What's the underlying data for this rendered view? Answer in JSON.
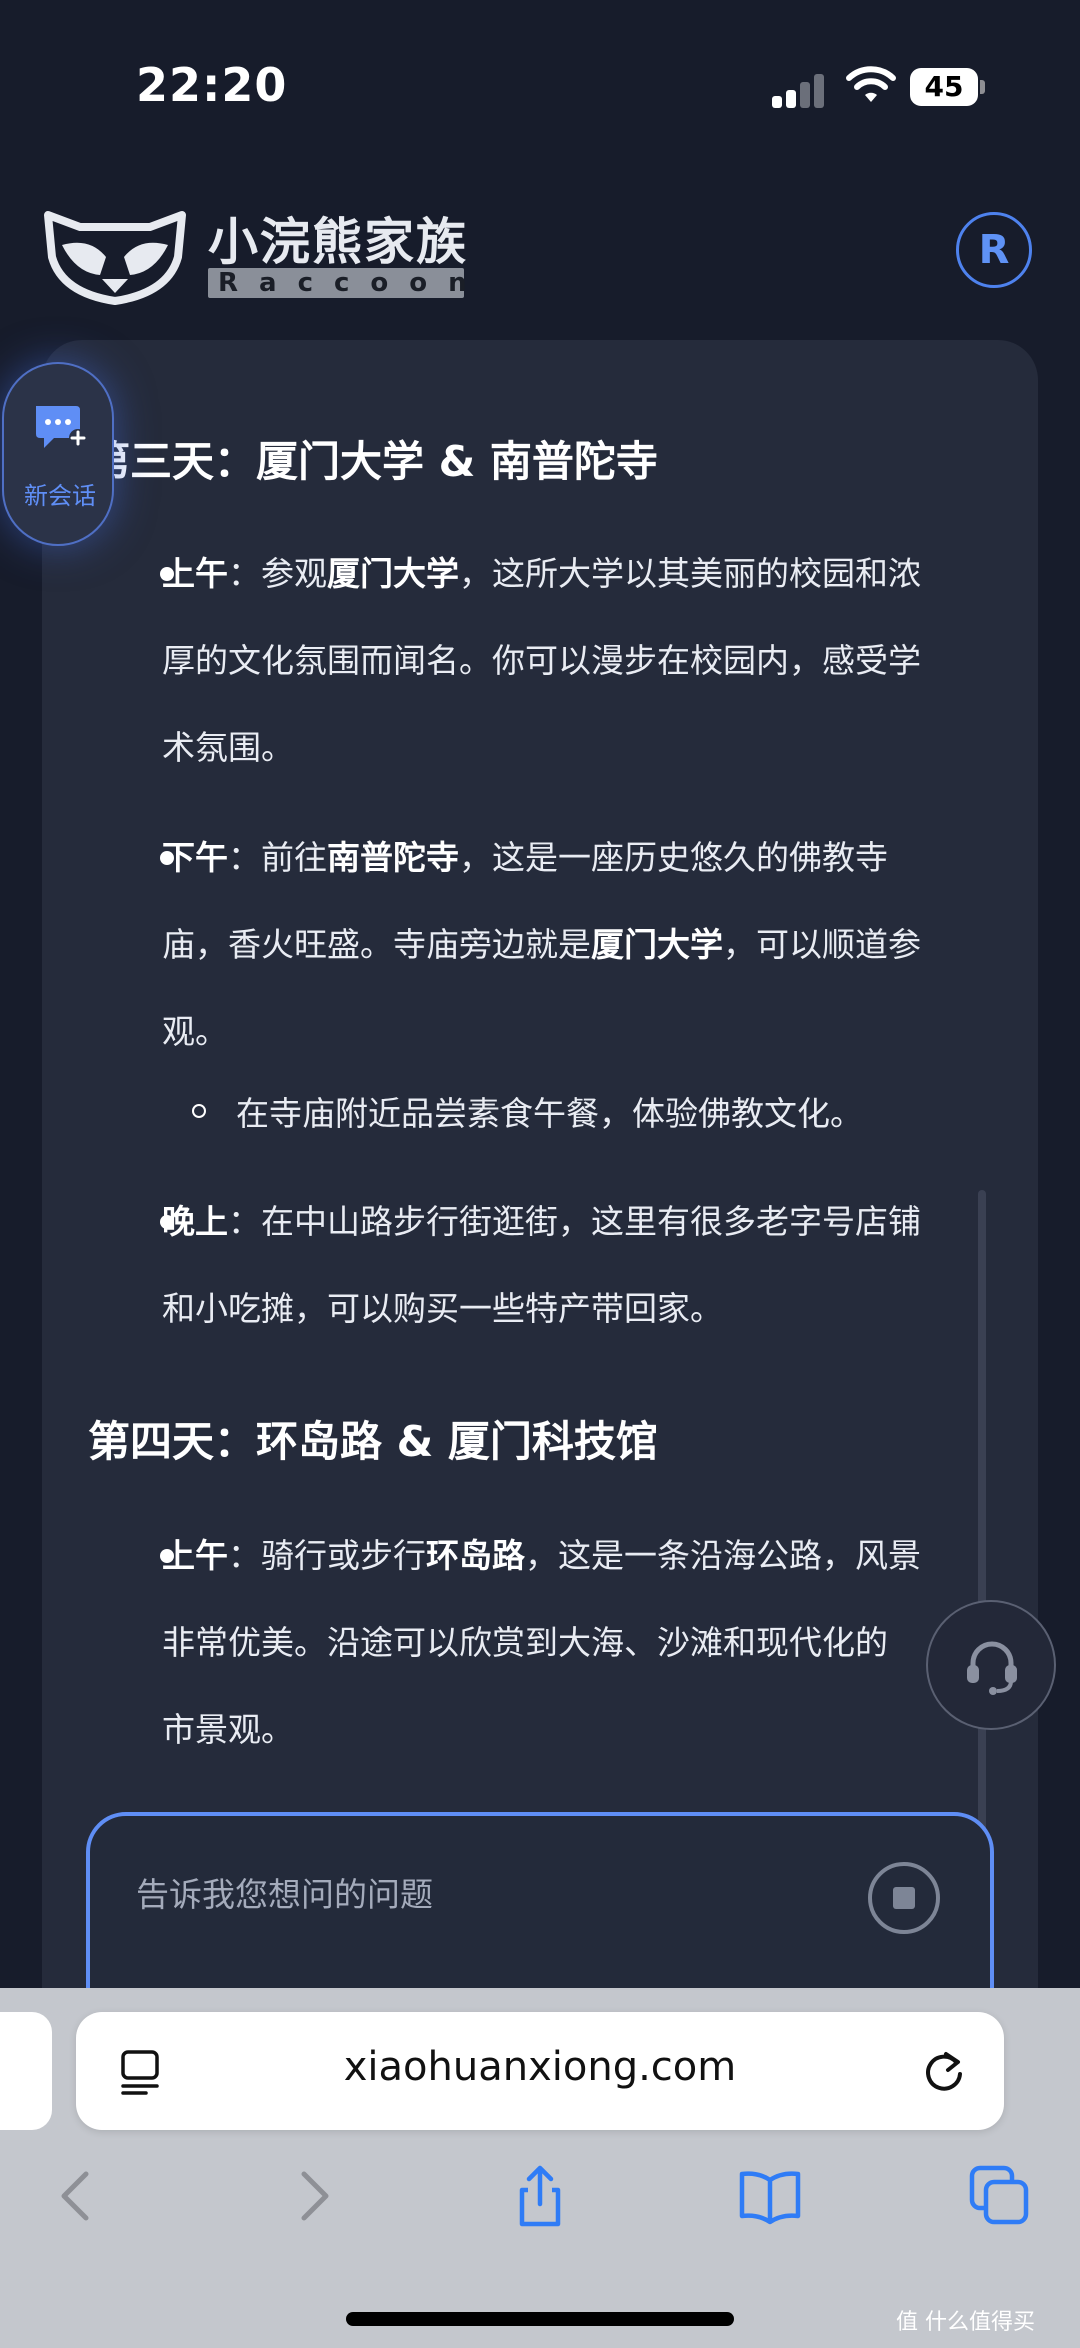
{
  "status_bar": {
    "time": "22:20",
    "battery": "45"
  },
  "header": {
    "brand_name": "小浣熊家族",
    "brand_sub": "Raccoon",
    "avatar_letter": "R"
  },
  "floating": {
    "new_chat_label": "新会话"
  },
  "chat": {
    "day3": {
      "title": "第三天：厦门大学 & 南普陀寺",
      "morning": {
        "label": "上午",
        "lines": [
          [
            "：参观",
            "厦门大学",
            "，这所大学以其美丽的校园和浓"
          ],
          "厚的文化氛围而闻名。你可以漫步在校园内，感受学",
          "术氛围。"
        ]
      },
      "afternoon": {
        "label": "下午",
        "lines": [
          [
            "：前往",
            "南普陀寺",
            "，这是一座历史悠久的佛教寺"
          ],
          [
            "庙，香火旺盛。寺庙旁边就是",
            "厦门大学",
            "，可以顺道参"
          ],
          "观。"
        ],
        "sub_item": "在寺庙附近品尝素食午餐，体验佛教文化。"
      },
      "evening": {
        "label": "晚上",
        "lines": [
          "：在中山路步行街逛街，这里有很多老字号店铺",
          "和小吃摊，可以购买一些特产带回家。"
        ]
      }
    },
    "day4": {
      "title": "第四天：环岛路 & 厦门科技馆",
      "morning": {
        "label": "上午",
        "lines": [
          [
            "：骑行或步行",
            "环岛路",
            "，这是一条沿海公路，风景"
          ],
          "非常优美。沿途可以欣赏到大海、沙滩和现代化的",
          "市景观。"
        ]
      }
    }
  },
  "input": {
    "placeholder": "告诉我您想问的问题"
  },
  "browser": {
    "url": "xiaohuanxiong.com"
  },
  "watermark": "值 什么值得买",
  "colors": {
    "accent": "#5f8ef5",
    "background": "#171c2b",
    "card": "#252b3b"
  }
}
